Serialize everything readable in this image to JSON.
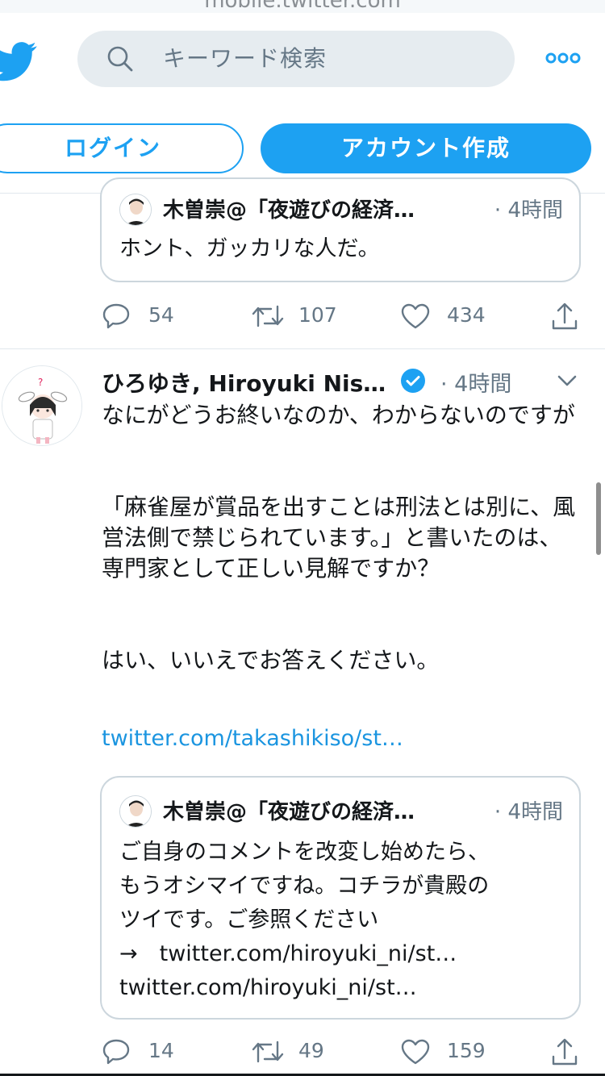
{
  "browser": {
    "url_text": "mobile.twitter.com"
  },
  "header": {
    "search_placeholder": "キーワード検索",
    "login_label": "ログイン",
    "signup_label": "アカウント作成"
  },
  "tweet1": {
    "quote": {
      "author": "木曽崇@「夜遊びの経済…",
      "time": "· 4時間",
      "text": "ホント、ガッカリな人だ。"
    },
    "reply_count": "54",
    "retweet_count": "107",
    "like_count": "434"
  },
  "tweet2": {
    "author": "ひろゆき, Hiroyuki Nis…",
    "time": "· 4時間",
    "body": [
      "なにがどうお終いなのか、わからないのですが",
      "",
      "「麻雀屋が賞品を出すことは刑法とは別に、風営法側で禁じられています。」と書いたのは、",
      "専門家として正しい見解ですか？",
      "",
      "はい、いいえでお答えください。"
    ],
    "link": "twitter.com/takashikiso/st…",
    "quote": {
      "author": "木曽崇@「夜遊びの経済…",
      "time": "· 4時間",
      "lines": [
        "ご自身のコメントを改変し始めたら、",
        "もうオシマイですね。コチラが貴殿の",
        "ツイです。ご参照ください",
        "→　twitter.com/hiroyuki_ni/st…",
        "twitter.com/hiroyuki_ni/st…"
      ]
    },
    "reply_count": "14",
    "retweet_count": "49",
    "like_count": "159"
  },
  "colors": {
    "brand": "#1da1f2",
    "link": "#1b95e0",
    "muted": "#657786",
    "border": "#ccd6dd"
  },
  "icons": [
    "twitter-bird-icon",
    "search-icon",
    "more-icon",
    "verified-icon",
    "chevron-down-icon",
    "reply-icon",
    "retweet-icon",
    "like-icon",
    "share-icon"
  ]
}
